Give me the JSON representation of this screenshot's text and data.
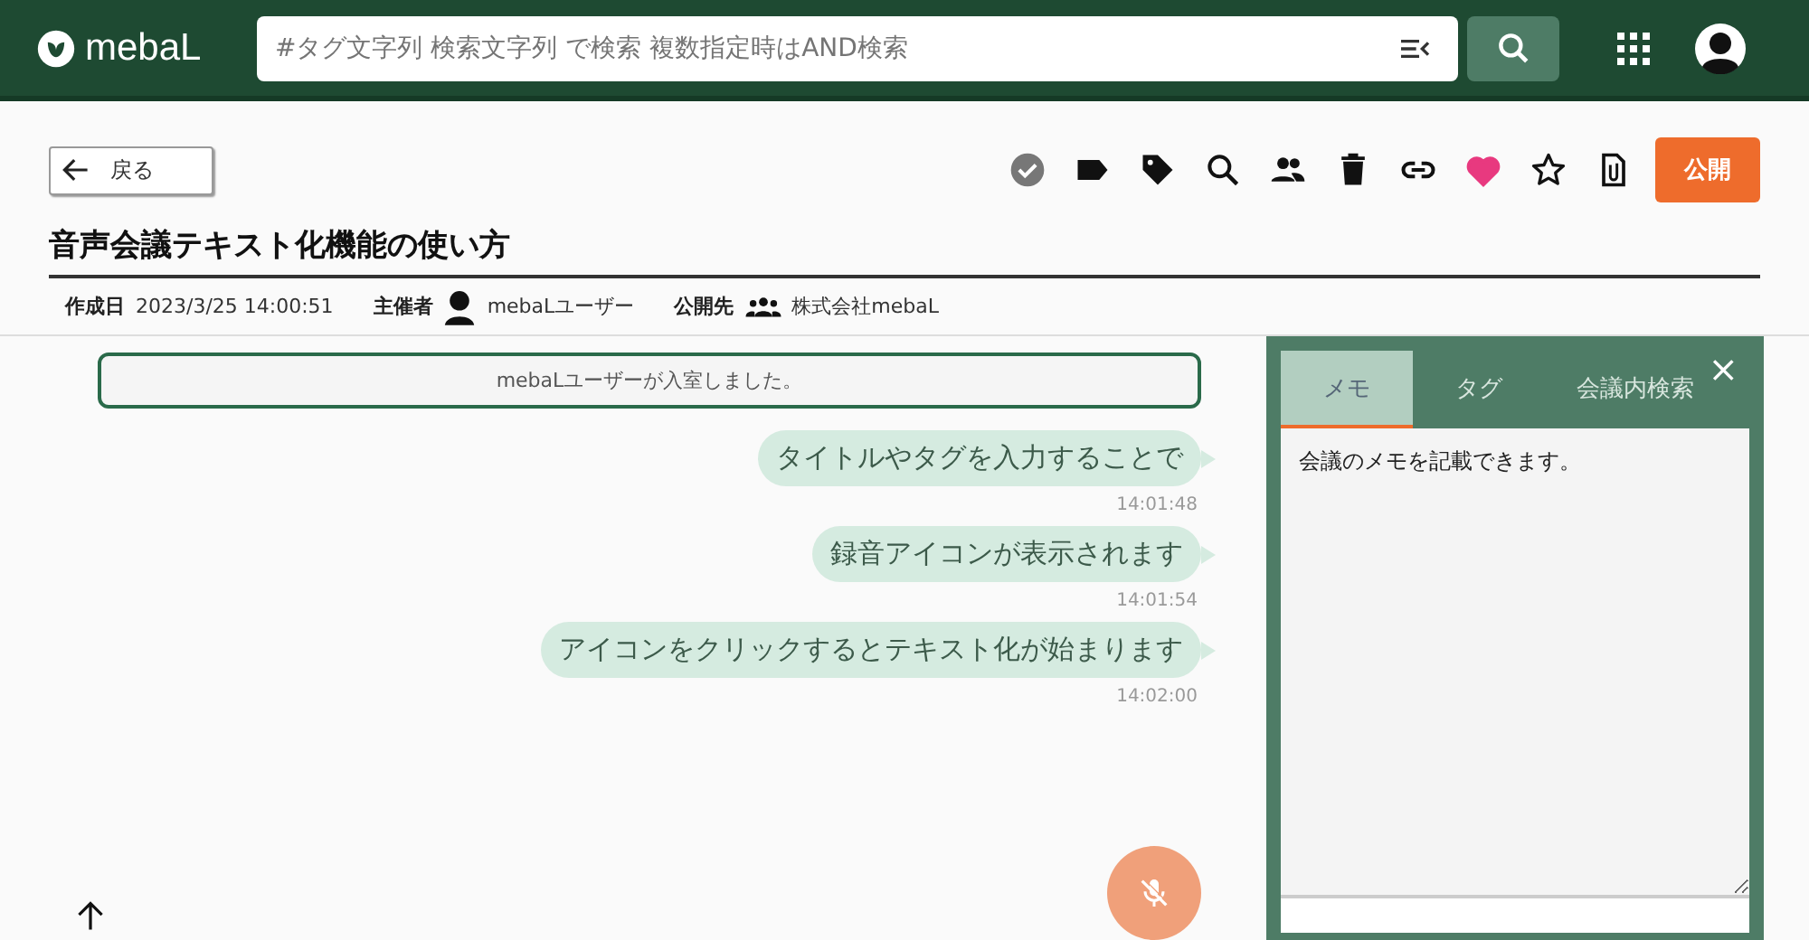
{
  "header": {
    "logo": "mebaL",
    "search": {
      "placeholder": "#タグ文字列 検索文字列 で検索 複数指定時はAND検索"
    }
  },
  "toolbar": {
    "back": "戻る",
    "icons": [
      {
        "kind": "check"
      },
      {
        "kind": "label"
      },
      {
        "kind": "tag"
      },
      {
        "kind": "search"
      },
      {
        "kind": "people"
      },
      {
        "kind": "trash"
      },
      {
        "kind": "link"
      },
      {
        "kind": "heart",
        "on": true
      },
      {
        "kind": "star",
        "on": false
      },
      {
        "kind": "clip"
      }
    ],
    "publish": "公開"
  },
  "meeting": {
    "title": "音声会議テキスト化機能の使い方",
    "created_label": "作成日",
    "created": "2023/3/25 14:00:51",
    "host_label": "主催者",
    "host": "mebaLユーザー",
    "share_label": "公開先",
    "share": "株式会社mebaL"
  },
  "chat": {
    "notice": "mebaLユーザーが入室しました。",
    "messages": [
      {
        "text": "タイトルやタグを入力することで",
        "time": "14:01:48"
      },
      {
        "text": "録音アイコンが表示されます",
        "time": "14:01:54"
      },
      {
        "text": "アイコンをクリックするとテキスト化が始まります",
        "time": "14:02:00"
      }
    ]
  },
  "panel": {
    "tabs": [
      {
        "label": "メモ",
        "selected": true
      },
      {
        "label": "タグ",
        "selected": false
      },
      {
        "label": "会議内検索",
        "selected": false
      }
    ],
    "close": "×",
    "memo": "会議のメモを記載できます。"
  }
}
